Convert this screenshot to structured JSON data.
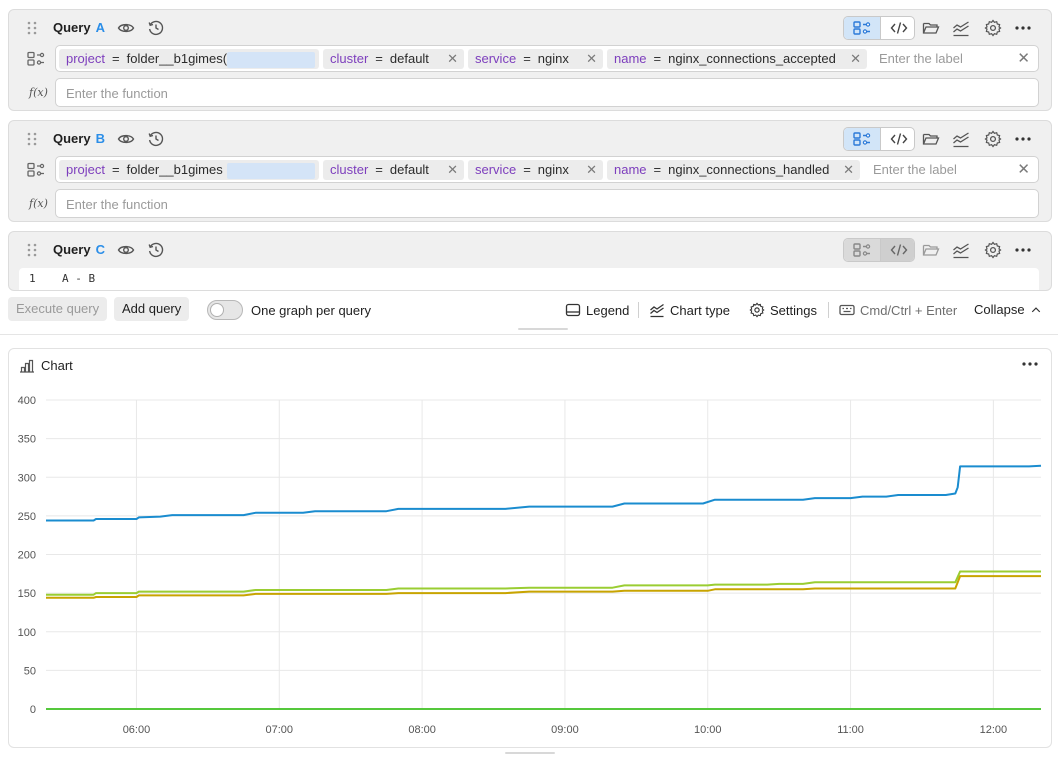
{
  "queries": [
    {
      "title": "Query",
      "letter": "A",
      "labels": [
        {
          "key": "project",
          "op": "=",
          "value": "folder__b1gimes("
        },
        {
          "key": "cluster",
          "op": "=",
          "value": "default"
        },
        {
          "key": "service",
          "op": "=",
          "value": "nginx"
        },
        {
          "key": "name",
          "op": "=",
          "value": "nginx_connections_accepted"
        }
      ],
      "label_placeholder": "Enter the label",
      "function_placeholder": "Enter the function"
    },
    {
      "title": "Query",
      "letter": "B",
      "labels": [
        {
          "key": "project",
          "op": "=",
          "value": "folder__b1gimes"
        },
        {
          "key": "cluster",
          "op": "=",
          "value": "default"
        },
        {
          "key": "service",
          "op": "=",
          "value": "nginx"
        },
        {
          "key": "name",
          "op": "=",
          "value": "nginx_connections_handled"
        }
      ],
      "label_placeholder": "Enter the label",
      "function_placeholder": "Enter the function"
    },
    {
      "title": "Query",
      "letter": "C",
      "code_line_number": "1",
      "code": "A - B"
    }
  ],
  "toolbar": {
    "execute_label": "Execute query",
    "add_label": "Add query",
    "toggle_label": "One graph per query",
    "legend_label": "Legend",
    "chart_type_label": "Chart type",
    "settings_label": "Settings",
    "shortcut_label": "Cmd/Ctrl + Enter",
    "collapse_label": "Collapse"
  },
  "chart_panel": {
    "title": "Chart"
  },
  "colors": {
    "accent": "#2b8ee8",
    "series_blue": "#1a8ccf",
    "series_lime": "#9acd32",
    "series_gold": "#c8a400",
    "series_green": "#55c83c",
    "label_key": "#7d3ebd"
  },
  "chart_data": {
    "type": "line",
    "x_ticks": [
      "06:00",
      "07:00",
      "08:00",
      "09:00",
      "10:00",
      "11:00",
      "12:00"
    ],
    "y_ticks": [
      0,
      50,
      100,
      150,
      200,
      250,
      300,
      350,
      400
    ],
    "ylim": [
      0,
      400
    ],
    "xlim": [
      "05:22",
      "12:20"
    ],
    "grid": true,
    "series": [
      {
        "color": "#1a8ccf",
        "points": [
          [
            "05:22",
            244
          ],
          [
            "05:42",
            244
          ],
          [
            "05:43",
            246
          ],
          [
            "06:00",
            246
          ],
          [
            "06:01",
            248
          ],
          [
            "06:10",
            249
          ],
          [
            "06:15",
            251
          ],
          [
            "06:45",
            251
          ],
          [
            "06:50",
            254
          ],
          [
            "07:10",
            254
          ],
          [
            "07:15",
            256
          ],
          [
            "07:45",
            256
          ],
          [
            "07:50",
            259
          ],
          [
            "08:35",
            259
          ],
          [
            "08:45",
            262
          ],
          [
            "09:20",
            262
          ],
          [
            "09:25",
            266
          ],
          [
            "09:58",
            266
          ],
          [
            "10:03",
            271
          ],
          [
            "10:40",
            271
          ],
          [
            "10:45",
            273
          ],
          [
            "11:00",
            273
          ],
          [
            "11:05",
            275
          ],
          [
            "11:15",
            275
          ],
          [
            "11:20",
            277
          ],
          [
            "11:40",
            277
          ],
          [
            "11:44",
            279
          ],
          [
            "11:45",
            287
          ],
          [
            "11:46",
            314
          ],
          [
            "12:15",
            314
          ],
          [
            "12:20",
            315
          ]
        ]
      },
      {
        "color": "#9acd32",
        "points": [
          [
            "05:22",
            148
          ],
          [
            "05:42",
            148
          ],
          [
            "05:43",
            150
          ],
          [
            "06:00",
            150
          ],
          [
            "06:01",
            152
          ],
          [
            "06:45",
            152
          ],
          [
            "06:50",
            154
          ],
          [
            "07:45",
            154
          ],
          [
            "07:50",
            156
          ],
          [
            "08:35",
            156
          ],
          [
            "08:45",
            157
          ],
          [
            "09:20",
            157
          ],
          [
            "09:25",
            160
          ],
          [
            "10:00",
            160
          ],
          [
            "10:03",
            161
          ],
          [
            "10:25",
            161
          ],
          [
            "10:30",
            162
          ],
          [
            "10:40",
            162
          ],
          [
            "10:45",
            164
          ],
          [
            "11:44",
            164
          ],
          [
            "11:46",
            178
          ],
          [
            "12:20",
            178
          ]
        ]
      },
      {
        "color": "#c8a400",
        "points": [
          [
            "05:22",
            144
          ],
          [
            "05:42",
            144
          ],
          [
            "05:43",
            145
          ],
          [
            "06:00",
            145
          ],
          [
            "06:01",
            147
          ],
          [
            "06:45",
            147
          ],
          [
            "06:50",
            149
          ],
          [
            "07:45",
            149
          ],
          [
            "07:50",
            150
          ],
          [
            "08:35",
            150
          ],
          [
            "08:45",
            152
          ],
          [
            "09:20",
            152
          ],
          [
            "09:25",
            153
          ],
          [
            "10:00",
            153
          ],
          [
            "10:03",
            155
          ],
          [
            "10:40",
            155
          ],
          [
            "10:45",
            156
          ],
          [
            "11:44",
            156
          ],
          [
            "11:46",
            172
          ],
          [
            "12:20",
            172
          ]
        ]
      },
      {
        "color": "#55c83c",
        "points": [
          [
            "05:22",
            0
          ],
          [
            "12:20",
            0
          ]
        ]
      }
    ]
  }
}
